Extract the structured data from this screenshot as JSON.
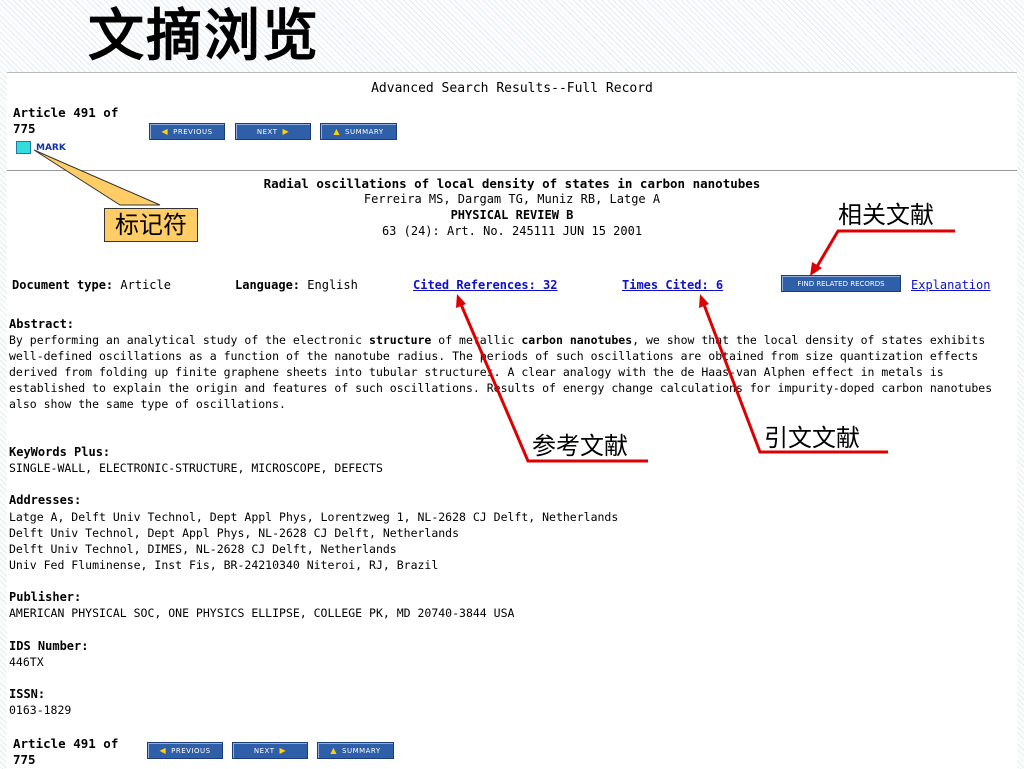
{
  "slide_title": "文摘浏览",
  "page": {
    "header": "Advanced Search Results--Full Record",
    "article_counter": [
      "Article 491 of",
      "775"
    ],
    "nav": {
      "previous": "PREVIOUS",
      "next": "NEXT",
      "summary": "SUMMARY"
    },
    "mark_label": "MARK"
  },
  "record": {
    "title": "Radial oscillations of local density of states in carbon nanotubes",
    "authors": "Ferreira MS, Dargam TG, Muniz RB, Latge A",
    "journal": "PHYSICAL REVIEW B",
    "citation": "63 (24): Art. No. 245111 JUN 15 2001"
  },
  "meta": {
    "doc_type_label": "Document type:",
    "doc_type_value": "Article",
    "language_label": "Language:",
    "language_value": "English",
    "cited_refs_link": "Cited References: 32",
    "times_cited_link": "Times Cited: 6",
    "find_related_button": "FIND RELATED RECORDS",
    "explanation_link": "Explanation"
  },
  "abstract": {
    "label": "Abstract:",
    "part1": "By performing an analytical study of the electronic ",
    "bold1": "structure",
    "part2": " of metallic ",
    "bold2": "carbon nanotubes",
    "part3": ", we show that the local density of states exhibits well-defined oscillations as a function of the nanotube radius. The periods of such oscillations are obtained from size quantization effects derived from folding up finite graphene sheets into tubular structures. A clear analogy with the de Haas-van Alphen effect in metals is established to explain the origin and features of such oscillations. Results of energy change calculations for impurity-doped carbon nanotubes also show the same type of oscillations."
  },
  "keywords": {
    "label": "KeyWords Plus:",
    "value": "SINGLE-WALL, ELECTRONIC-STRUCTURE, MICROSCOPE, DEFECTS"
  },
  "addresses": {
    "label": "Addresses:",
    "lines": [
      "Latge A, Delft Univ Technol, Dept Appl Phys, Lorentzweg 1, NL-2628 CJ Delft, Netherlands",
      "Delft Univ Technol, Dept Appl Phys, NL-2628 CJ Delft, Netherlands",
      "Delft Univ Technol, DIMES, NL-2628 CJ Delft, Netherlands",
      "Univ Fed Fluminense, Inst Fis, BR-24210340 Niteroi, RJ, Brazil"
    ]
  },
  "publisher": {
    "label": "Publisher:",
    "value": "AMERICAN PHYSICAL SOC, ONE PHYSICS ELLIPSE, COLLEGE PK, MD 20740-3844 USA"
  },
  "ids": {
    "label": "IDS Number:",
    "value": "446TX"
  },
  "issn": {
    "label": "ISSN:",
    "value": "0163-1829"
  },
  "callouts": {
    "marker": "标记符",
    "related": "相关文献",
    "references": "参考文献",
    "citations": "引文文献"
  },
  "colors": {
    "button_blue": "#2f5fa8",
    "link_blue": "#1010cc",
    "arrow_red": "#dd0000",
    "callout_fill": "#ffcc66",
    "mark_cyan": "#33dddd"
  }
}
